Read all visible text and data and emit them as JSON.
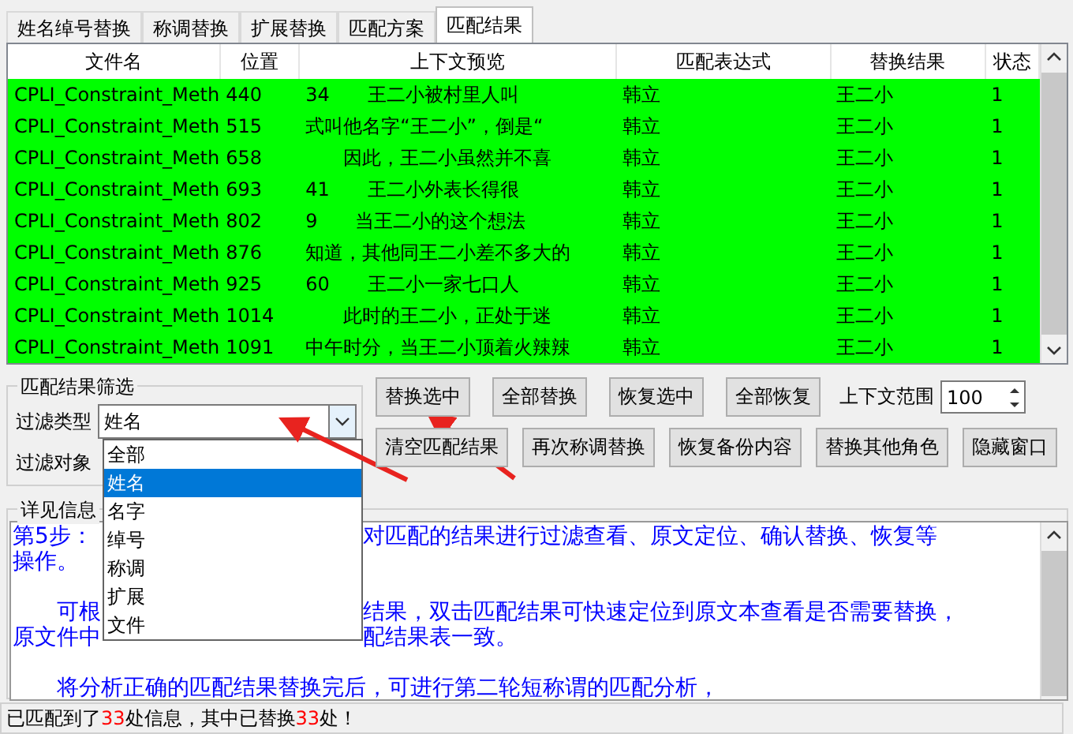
{
  "tabs": [
    {
      "label": "姓名绰号替换",
      "selected": false
    },
    {
      "label": "称调替换",
      "selected": false
    },
    {
      "label": "扩展替换",
      "selected": false
    },
    {
      "label": "匹配方案",
      "selected": false
    },
    {
      "label": "匹配结果",
      "selected": true
    }
  ],
  "table": {
    "columns": [
      "文件名",
      "位置",
      "上下文预览",
      "匹配表达式",
      "替换结果",
      "状态"
    ],
    "rows": [
      {
        "cells": [
          "CPLI_Constraint_Meth",
          "440",
          "34　　王二小被村里人叫",
          "韩立",
          "王二小",
          "1"
        ],
        "replaced": true
      },
      {
        "cells": [
          "CPLI_Constraint_Meth",
          "515",
          "式叫他名字“王二小”，倒是“",
          "韩立",
          "王二小",
          "1"
        ],
        "replaced": true
      },
      {
        "cells": [
          "CPLI_Constraint_Meth",
          "658",
          "　　因此，王二小虽然并不喜",
          "韩立",
          "王二小",
          "1"
        ],
        "replaced": true
      },
      {
        "cells": [
          "CPLI_Constraint_Meth",
          "693",
          "41　　王二小外表长得很",
          "韩立",
          "王二小",
          "1"
        ],
        "replaced": true
      },
      {
        "cells": [
          "CPLI_Constraint_Meth",
          "802",
          "9　　当王二小的这个想法",
          "韩立",
          "王二小",
          "1"
        ],
        "replaced": true
      },
      {
        "cells": [
          "CPLI_Constraint_Meth",
          "876",
          "知道，其他同王二小差不多大的",
          "韩立",
          "王二小",
          "1"
        ],
        "replaced": true
      },
      {
        "cells": [
          "CPLI_Constraint_Meth",
          "925",
          "60　　王二小一家七口人",
          "韩立",
          "王二小",
          "1"
        ],
        "replaced": true
      },
      {
        "cells": [
          "CPLI_Constraint_Meth",
          "1014",
          "　　此时的王二小，正处于迷",
          "韩立",
          "王二小",
          "1"
        ],
        "replaced": true
      },
      {
        "cells": [
          "CPLI_Constraint_Meth",
          "1091",
          "中午时分，当王二小顶着火辣辣",
          "韩立",
          "王二小",
          "1"
        ],
        "replaced": true
      }
    ]
  },
  "filter": {
    "title": "匹配结果筛选",
    "type_label": "过滤类型",
    "type_value": "姓名",
    "object_label": "过滤对象",
    "dropdown": [
      {
        "label": "全部",
        "selected": false
      },
      {
        "label": "姓名",
        "selected": true
      },
      {
        "label": "名字",
        "selected": false
      },
      {
        "label": "绰号",
        "selected": false
      },
      {
        "label": "称调",
        "selected": false
      },
      {
        "label": "扩展",
        "selected": false
      },
      {
        "label": "文件",
        "selected": false
      }
    ]
  },
  "buttons_row1": [
    "替换选中",
    "全部替换",
    "恢复选中",
    "全部恢复"
  ],
  "range": {
    "label": "上下文范围",
    "value": "100"
  },
  "buttons_row2": [
    "清空匹配结果",
    "再次称调替换",
    "恢复备份内容",
    "替换其他角色",
    "隐藏窗口"
  ],
  "detail": {
    "title": "详见信息",
    "lines": [
      {
        "left": "第5步：",
        "right": "对匹配的结果进行过滤查看、原文定位、确认替换、恢复等"
      },
      {
        "left": "操作。"
      },
      {
        "left": "　　可根",
        "space_before": true,
        "right": "结果，双击匹配结果可快速定位到原文本查看是否需要替换，"
      },
      {
        "left": "原文件中",
        "right": "配结果表一致。"
      },
      {
        "space_before": true,
        "left": "　　将分析正确的匹配结果替换完后，可进行第二轮短称谓的匹配分析，"
      }
    ]
  },
  "status_bar": {
    "parts": [
      {
        "text": "已匹配到了",
        "kind": "plain"
      },
      {
        "text": "33",
        "kind": "count"
      },
      {
        "text": "处信息，其中已替换",
        "kind": "plain"
      },
      {
        "text": "33",
        "kind": "count"
      },
      {
        "text": "处！",
        "kind": "plain"
      }
    ]
  }
}
